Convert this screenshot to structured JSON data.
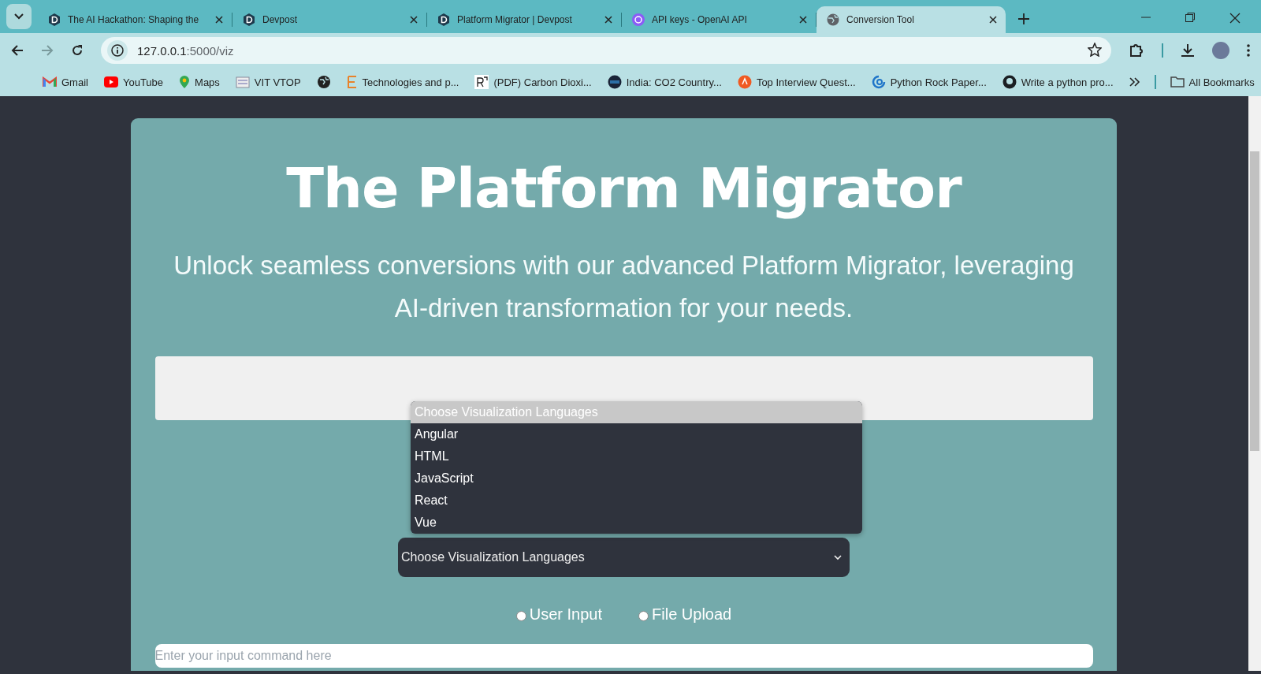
{
  "tabs": [
    {
      "title": "The AI Hackathon: Shaping the",
      "selected": false
    },
    {
      "title": "Devpost",
      "selected": false
    },
    {
      "title": "Platform Migrator | Devpost",
      "selected": false
    },
    {
      "title": "API keys - OpenAI API",
      "selected": false
    },
    {
      "title": "Conversion Tool",
      "selected": true
    }
  ],
  "address": {
    "host": "127.0.0.1",
    "path": ":5000/viz"
  },
  "bookmarks": [
    {
      "label": "Gmail"
    },
    {
      "label": "YouTube"
    },
    {
      "label": "Maps"
    },
    {
      "label": "VIT VTOP"
    },
    {
      "label": "Technologies and p..."
    },
    {
      "label": "(PDF) Carbon Dioxi..."
    },
    {
      "label": "India: CO2 Country..."
    },
    {
      "label": "Top Interview Quest..."
    },
    {
      "label": "Python Rock Paper..."
    },
    {
      "label": "Write a python pro..."
    }
  ],
  "all_bookmarks": "All Bookmarks",
  "page": {
    "title": "The Platform Migrator",
    "subtitle": "Unlock seamless conversions with our advanced Platform Migrator, leveraging AI-driven transformation for your needs.",
    "dropdown_options": [
      {
        "label": "Choose Visualization Languages",
        "selected": true
      },
      {
        "label": "Angular",
        "selected": false
      },
      {
        "label": "HTML",
        "selected": false
      },
      {
        "label": "JavaScript",
        "selected": false
      },
      {
        "label": "React",
        "selected": false
      },
      {
        "label": "Vue",
        "selected": false
      }
    ],
    "select": {
      "value": "Choose Visualization Languages"
    },
    "radios": [
      {
        "label": "User Input",
        "selected": false
      },
      {
        "label": "File Upload",
        "selected": false
      }
    ],
    "input": {
      "placeholder": "Enter your input command here"
    }
  }
}
